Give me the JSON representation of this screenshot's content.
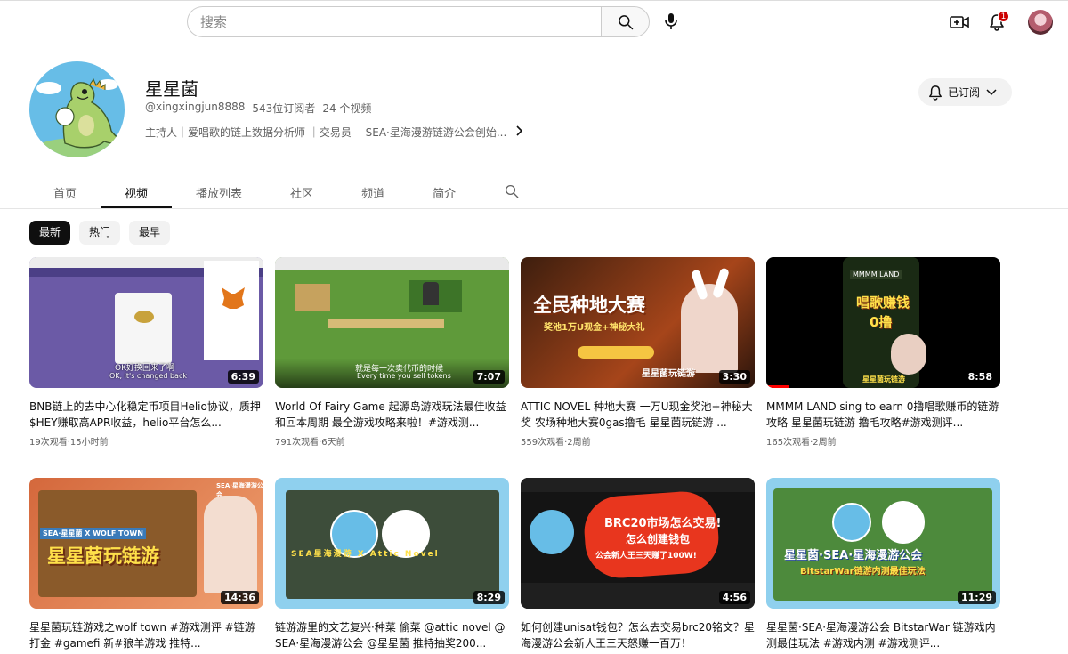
{
  "topbar": {
    "search_placeholder": "搜索",
    "notification_count": "1"
  },
  "channel": {
    "name": "星星菌",
    "handle": "@xingxingjun8888",
    "subscribers": "543位订阅者",
    "video_count": "24 个视频",
    "description": "主持人｜爱唱歌的链上数据分析师 ｜交易员 ｜SEA·星海漫游链游公会创始...",
    "subscribe_label": "已订阅"
  },
  "tabs": [
    {
      "label": "首页"
    },
    {
      "label": "视频"
    },
    {
      "label": "播放列表"
    },
    {
      "label": "社区"
    },
    {
      "label": "频道"
    },
    {
      "label": "简介"
    }
  ],
  "chips": [
    {
      "label": "最新"
    },
    {
      "label": "热门"
    },
    {
      "label": "最早"
    }
  ],
  "videos": [
    {
      "title": "BNB链上的去中心化稳定币项目Helio协议，质押$HEY赚取高APR收益，helio平台怎么...",
      "views": "19次观看",
      "age": "15小时前",
      "duration": "6:39",
      "thumb_caption": "OK好换回来了啊",
      "thumb_caption2": "OK, it's changed back"
    },
    {
      "title": "World Of Fairy Game 起源岛游戏玩法最佳收益和回本周期 最全游戏攻略来啦！#游戏测...",
      "views": "791次观看",
      "age": "6天前",
      "duration": "7:07",
      "thumb_caption": "就是每一次卖代币的时候",
      "thumb_caption2": "Every time you sell tokens"
    },
    {
      "title": "ATTIC NOVEL 种地大赛 一万U现金奖池+神秘大奖 农场种地大赛0gas撸毛 星星菌玩链游 ...",
      "views": "559次观看",
      "age": "2周前",
      "duration": "3:30",
      "thumb_caption": "全民种地大赛",
      "thumb_caption2": "奖池1万U现金+神秘大礼",
      "thumb_caption3": "星星菌玩链游"
    },
    {
      "title": "MMMM LAND sing to earn 0撸唱歌赚币的链游攻略 星星菌玩链游 撸毛攻略#游戏测评...",
      "views": "165次观看",
      "age": "2周前",
      "duration": "8:58",
      "thumb_caption": "MMMM LAND",
      "thumb_caption2": "唱歌赚钱",
      "thumb_caption3": "0撸",
      "thumb_caption4": "星星菌玩链游"
    },
    {
      "title": "星星菌玩链游戏之wolf town #游戏测评 #链游打金 #gamefi 新#狼羊游戏 推特...",
      "views": "",
      "age": "",
      "duration": "14:36",
      "thumb_caption": "SEA·星星菌 X WOLF TOWN",
      "thumb_caption2": "星星菌玩链游",
      "thumb_caption3": "SEA·星海漫游公会"
    },
    {
      "title": "链游游里的文艺复兴·种菜 偷菜 @attic novel @SEA·星海漫游公会 @星星菌 推特抽奖200...",
      "views": "",
      "age": "",
      "duration": "8:29",
      "thumb_caption": "SEA星海漫游 X Attic Novel"
    },
    {
      "title": "如何创建unisat钱包？怎么去交易brc20铭文？星海漫游公会新人王三天怒赚一百万！",
      "views": "",
      "age": "",
      "duration": "4:56",
      "thumb_caption": "BRC20市场怎么交易!",
      "thumb_caption2": "怎么创建钱包",
      "thumb_caption3": "公会新人王三天赚了100W!"
    },
    {
      "title": "星星菌·SEA·星海漫游公会 BitstarWar 链游戏内测最佳玩法 #游戏内测 #游戏测评...",
      "views": "",
      "age": "",
      "duration": "11:29",
      "thumb_caption": "星星菌·SEA·星海漫游公会",
      "thumb_caption2": "BitstarWar链游内测最佳玩法"
    }
  ],
  "colors": {
    "accent_red": "#ff0000",
    "text_primary": "#0f0f0f",
    "text_secondary": "#606060",
    "chip_bg": "#f2f2f2"
  }
}
